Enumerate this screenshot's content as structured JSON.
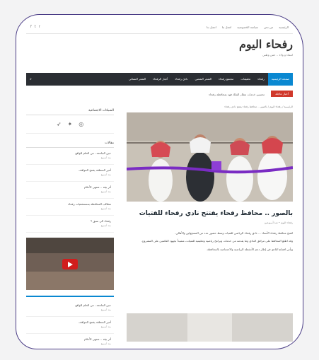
{
  "topbar": {
    "links": [
      "الرئيسية",
      "من نحن",
      "سياسة الخصوصية",
      "اتصل بنا",
      "اتصل بنا"
    ],
    "icons": [
      "facebook-icon",
      "twitter-icon",
      "rss-icon"
    ]
  },
  "brand": {
    "name": "رفحاء اليوم",
    "tagline": "انتماء و ولاء .. حس وطني"
  },
  "nav": {
    "items": [
      "صفحة الرئيسية",
      "رفحاء",
      "تحقيقات",
      "مجتمع رفحاء",
      "الشعر الشعبي",
      "نادي رفحاء",
      "أخبار الرفحاء",
      "الشعر النسائي"
    ],
    "active": "صفحة الرئيسية"
  },
  "ticker": {
    "label": "أخبار عاجلة",
    "text": "تحسين خدمات مطار الملك فهد بمحافظة رفحاء"
  },
  "breadcrumb": "الرئيسية / رفحاء اليوم / بالصور .. محافظ رفحاء يفتتح نادي رفحاء",
  "article": {
    "title": "بالصور .. محافظ رفحاء يفتتح نادي رفحاء للفتيات",
    "meta": "رفحاء اليوم • منذ أسبوعين",
    "paragraphs": [
      "افتتح محافظ رفحاء الأستاذ ... نادي رفحاء الرياضي للفتيات وسط حضور عدد من المسؤولين والأهالي.",
      "وقد اطلع المحافظ على مرافق النادي وما يقدمه من خدمات وبرامج رياضية وتعليمية للفتيات، مشيداً بجهود القائمين على المشروع.",
      "ويأتي افتتاح النادي في إطار دعم الأنشطة الرياضية والاجتماعية بالمحافظة."
    ]
  },
  "sidebar": {
    "social_title": "الشبكات الاجتماعية",
    "latest_title": "مقالات",
    "latest": [
      {
        "title": "حين الجامعة.. من الحلم للواقع",
        "date": "منذ أسبوع"
      },
      {
        "title": "أمير المنطقة يفتتح المواقف",
        "date": "منذ أسبوع"
      },
      {
        "title": "أثر بيئة .. منتهى الأعلام",
        "date": "منذ أسبوع"
      },
      {
        "title": "مطالب المحافظة بمستشفيات رفحاء",
        "date": "منذ أسبوع"
      },
      {
        "title": "رفحاء الى سبق ؟",
        "date": "منذ أسبوع"
      }
    ],
    "latest2": [
      {
        "title": "حين الجامعة.. من الحلم للواقع",
        "date": "منذ أسبوع"
      },
      {
        "title": "أمير المنطقة يفتتح المواقف",
        "date": "منذ أسبوع"
      },
      {
        "title": "أثر بيئة .. منتهى الأعلام",
        "date": "منذ أسبوع"
      }
    ]
  },
  "colors": {
    "accent": "#0a88d1",
    "nav": "#2b2e33",
    "breaking": "#d0382b",
    "frame": "#4a3c86"
  }
}
